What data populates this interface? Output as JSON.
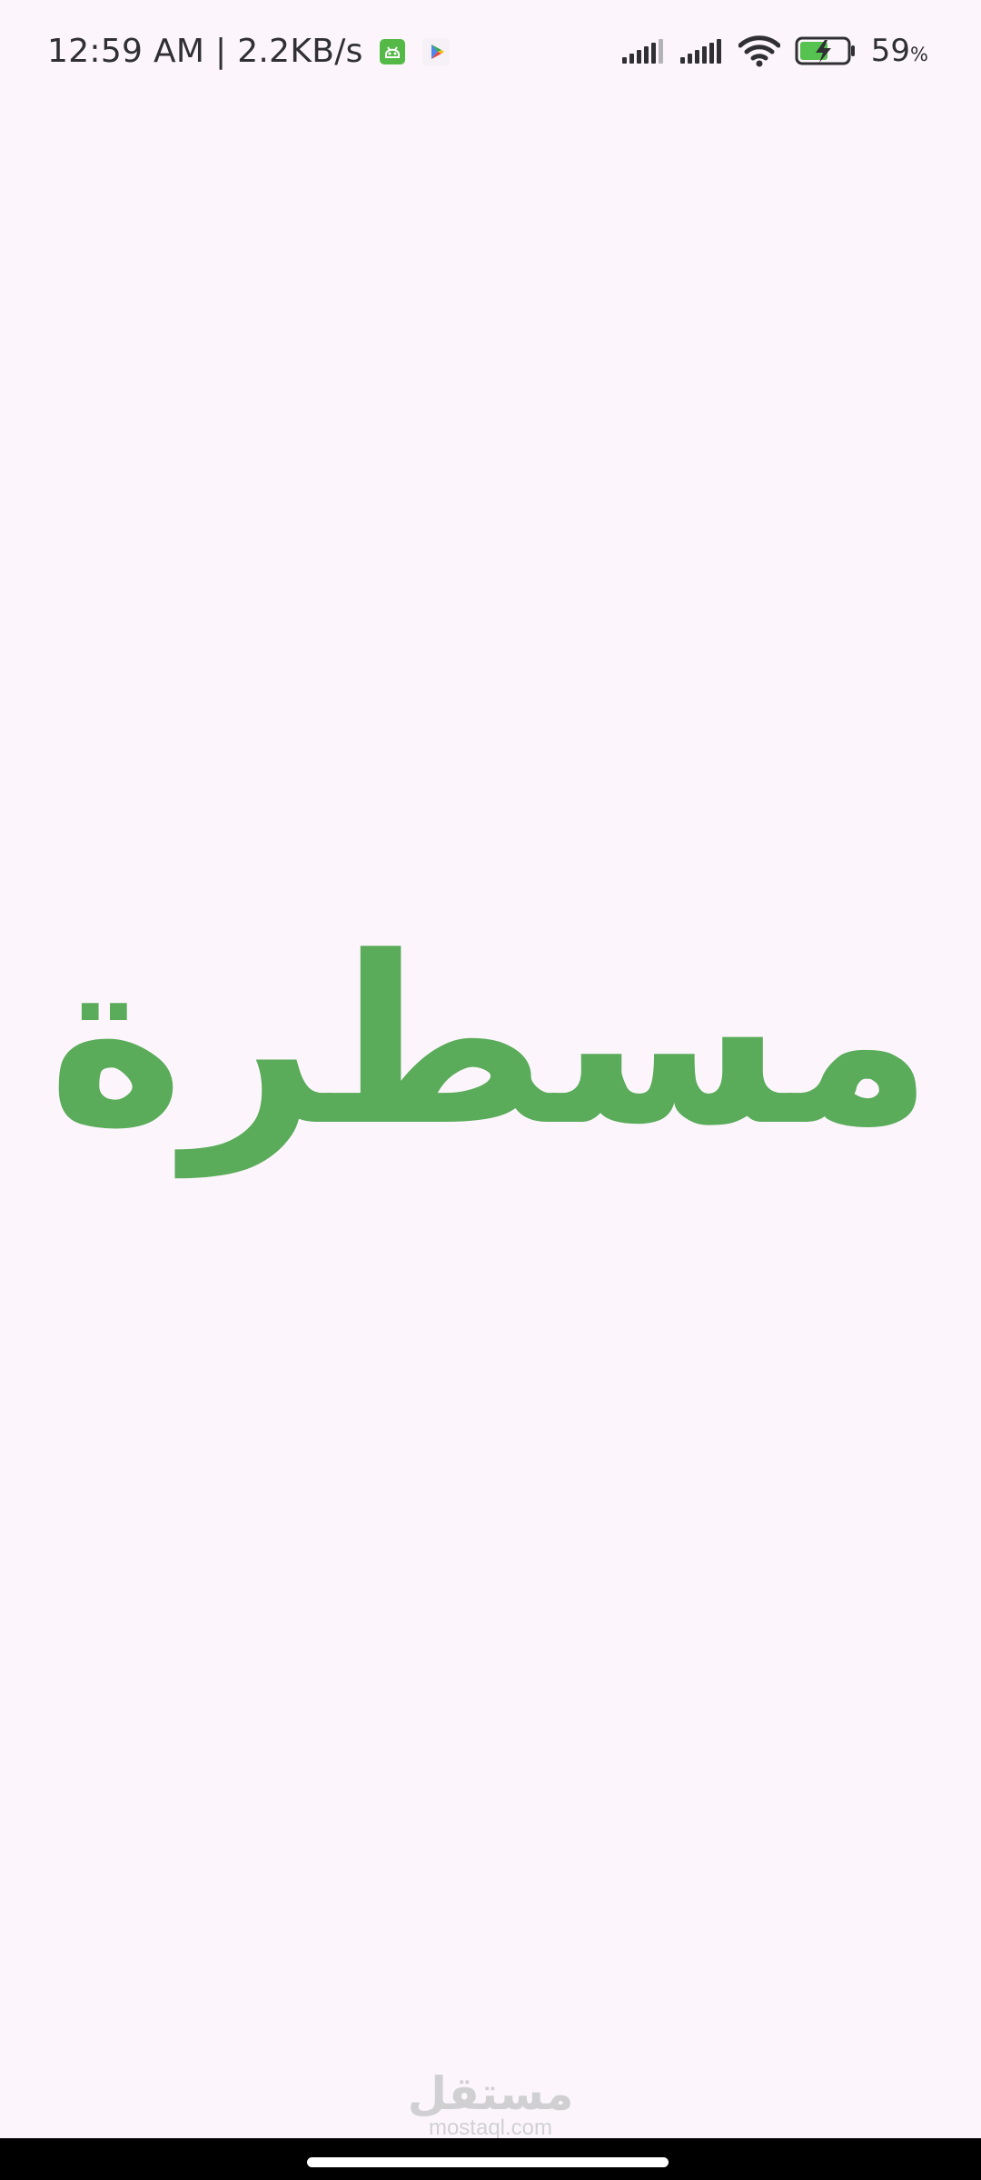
{
  "status_bar": {
    "time_speed": "12:59 AM | 2.2KB/s",
    "battery_number": "59",
    "battery_unit": "%",
    "notification_icons": [
      "android-notification-icon",
      "play-store-icon"
    ],
    "system_icons": [
      "cellular-signal-icon",
      "cellular-signal-icon",
      "wifi-icon",
      "battery-charging-icon"
    ]
  },
  "splash": {
    "title": "مسطرة",
    "title_color": "#5aab5a"
  },
  "watermark": {
    "arabic": "مستقل",
    "latin": "mostaql.com"
  },
  "colors": {
    "background": "#fcf6fc",
    "nav_bar": "#000000",
    "home_indicator": "#ffffff"
  }
}
